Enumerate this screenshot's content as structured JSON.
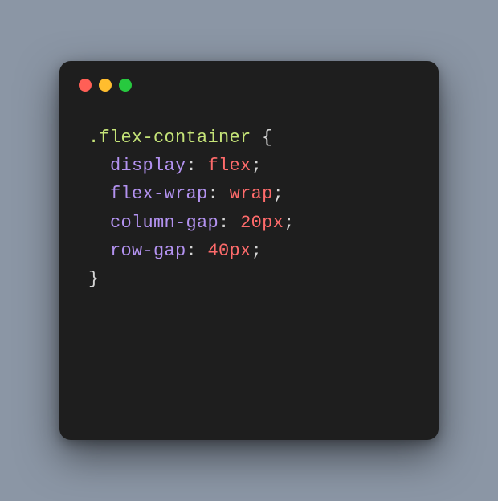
{
  "code": {
    "selector": ".flex-container",
    "open_brace": " {",
    "close_brace": "}",
    "indent": "  ",
    "colon_space": ": ",
    "semicolon": ";",
    "lines": [
      {
        "property": "display",
        "value": "flex"
      },
      {
        "property": "flex-wrap",
        "value": "wrap"
      },
      {
        "property": "column-gap",
        "value": "20px"
      },
      {
        "property": "row-gap",
        "value": "40px"
      }
    ]
  }
}
